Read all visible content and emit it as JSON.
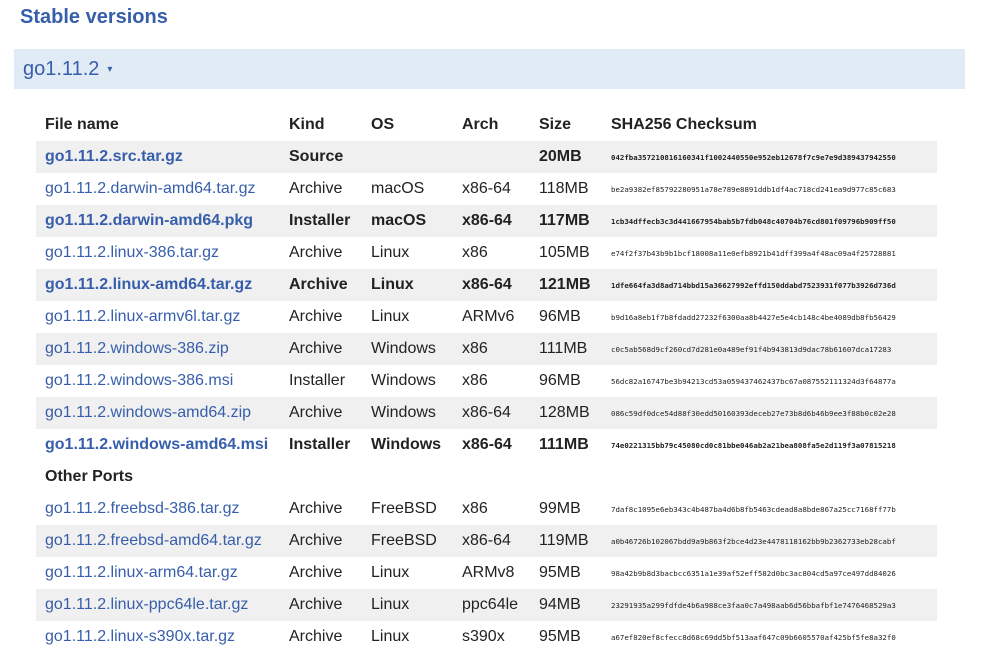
{
  "page_title": "Stable versions",
  "version": {
    "label": "go1.11.2",
    "caret": "▾"
  },
  "table": {
    "headers": {
      "file": "File name",
      "kind": "Kind",
      "os": "OS",
      "arch": "Arch",
      "size": "Size",
      "sum": "SHA256 Checksum"
    },
    "rows": [
      {
        "file": "go1.11.2.src.tar.gz",
        "kind": "Source",
        "os": "",
        "arch": "",
        "size": "20MB",
        "sum": "042fba357210816160341f1002440550e952eb12678f7c9e7e9d389437942550",
        "highlight": true
      },
      {
        "file": "go1.11.2.darwin-amd64.tar.gz",
        "kind": "Archive",
        "os": "macOS",
        "arch": "x86-64",
        "size": "118MB",
        "sum": "be2a9382ef85792280951a78e789e8891ddb1df4ac718cd241ea9d977c85c683",
        "highlight": false
      },
      {
        "file": "go1.11.2.darwin-amd64.pkg",
        "kind": "Installer",
        "os": "macOS",
        "arch": "x86-64",
        "size": "117MB",
        "sum": "1cb34dffecb3c3d441667954bab5b7fdb048c40704b76cd801f09796b909ff50",
        "highlight": true
      },
      {
        "file": "go1.11.2.linux-386.tar.gz",
        "kind": "Archive",
        "os": "Linux",
        "arch": "x86",
        "size": "105MB",
        "sum": "e74f2f37b43b9b1bcf18008a11e0efb8921b41dff399a4f48ac09a4f25728881",
        "highlight": false
      },
      {
        "file": "go1.11.2.linux-amd64.tar.gz",
        "kind": "Archive",
        "os": "Linux",
        "arch": "x86-64",
        "size": "121MB",
        "sum": "1dfe664fa3d8ad714bbd15a36627992effd150ddabd7523931f077b3926d736d",
        "highlight": true
      },
      {
        "file": "go1.11.2.linux-armv6l.tar.gz",
        "kind": "Archive",
        "os": "Linux",
        "arch": "ARMv6",
        "size": "96MB",
        "sum": "b9d16a8eb1f7b8fdadd27232f6300aa8b4427e5e4cb148c4be4089db8fb56429",
        "highlight": false
      },
      {
        "file": "go1.11.2.windows-386.zip",
        "kind": "Archive",
        "os": "Windows",
        "arch": "x86",
        "size": "111MB",
        "sum": "c0c5ab568d9cf260cd7d281e0a489ef91f4b943813d9dac78b61607dca17283",
        "highlight": false
      },
      {
        "file": "go1.11.2.windows-386.msi",
        "kind": "Installer",
        "os": "Windows",
        "arch": "x86",
        "size": "96MB",
        "sum": "56dc82a16747be3b94213cd53a059437462437bc67a087552111324d3f64877a",
        "highlight": false
      },
      {
        "file": "go1.11.2.windows-amd64.zip",
        "kind": "Archive",
        "os": "Windows",
        "arch": "x86-64",
        "size": "128MB",
        "sum": "086c59df0dce54d88f30edd50160393deceb27e73b8d6b46b9ee3f88b0c02e28",
        "highlight": false
      },
      {
        "file": "go1.11.2.windows-amd64.msi",
        "kind": "Installer",
        "os": "Windows",
        "arch": "x86-64",
        "size": "111MB",
        "sum": "74e0221315bb79c45080cd0c81bbe046ab2a21bea808fa5e2d119f3a07815218",
        "highlight": true
      }
    ],
    "section_label": "Other Ports",
    "other_rows": [
      {
        "file": "go1.11.2.freebsd-386.tar.gz",
        "kind": "Archive",
        "os": "FreeBSD",
        "arch": "x86",
        "size": "99MB",
        "sum": "7daf8c1095e6eb343c4b487ba4d6b8fb5463cdead8a8bde867a25cc7168ff77b"
      },
      {
        "file": "go1.11.2.freebsd-amd64.tar.gz",
        "kind": "Archive",
        "os": "FreeBSD",
        "arch": "x86-64",
        "size": "119MB",
        "sum": "a0b46726b102067bdd9a9b863f2bce4d23e4478118162bb9b2362733eb28cabf"
      },
      {
        "file": "go1.11.2.linux-arm64.tar.gz",
        "kind": "Archive",
        "os": "Linux",
        "arch": "ARMv8",
        "size": "95MB",
        "sum": "98a42b9b8d3bacbcc6351a1e39af52eff582d0bc3ac804cd5a97ce497dd84026"
      },
      {
        "file": "go1.11.2.linux-ppc64le.tar.gz",
        "kind": "Archive",
        "os": "Linux",
        "arch": "ppc64le",
        "size": "94MB",
        "sum": "23291935a299fdfde4b6a988ce3faa0c7a498aab6d56bbafbf1e7476468529a3"
      },
      {
        "file": "go1.11.2.linux-s390x.tar.gz",
        "kind": "Archive",
        "os": "Linux",
        "arch": "s390x",
        "size": "95MB",
        "sum": "a67ef820ef8cfecc8d68c69dd5bf513aaf647c09b6605570af425bf5fe8a32f0"
      }
    ]
  }
}
